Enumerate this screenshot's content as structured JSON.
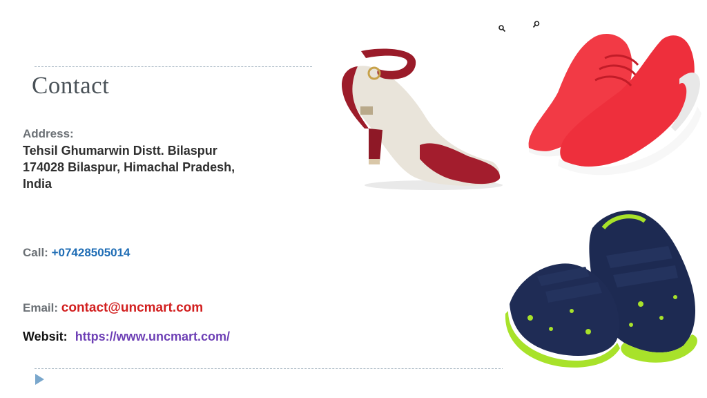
{
  "title": "Contact",
  "address": {
    "label": "Address:",
    "lines": [
      "Tehsil Ghumarwin Distt. Bilaspur",
      "174028 Bilaspur, Himachal Pradesh,",
      "India"
    ]
  },
  "call": {
    "label": "Call:",
    "phone": "+07428505014"
  },
  "email": {
    "label": "Email:",
    "address": "contact@uncmart.com"
  },
  "website": {
    "label": "Websit:",
    "url": "https://www.uncmart.com/"
  },
  "images": [
    {
      "name": "red-block-heel-sandal"
    },
    {
      "name": "red-sports-shoes"
    },
    {
      "name": "navy-green-kids-shoes"
    }
  ],
  "icons": [
    "zoom-icon",
    "zoom-icon",
    "play-arrow-icon"
  ],
  "colors": {
    "phone": "#1f6db5",
    "email": "#d21f1f",
    "url": "#6d3fb5",
    "accent": "#7aa7cc"
  }
}
